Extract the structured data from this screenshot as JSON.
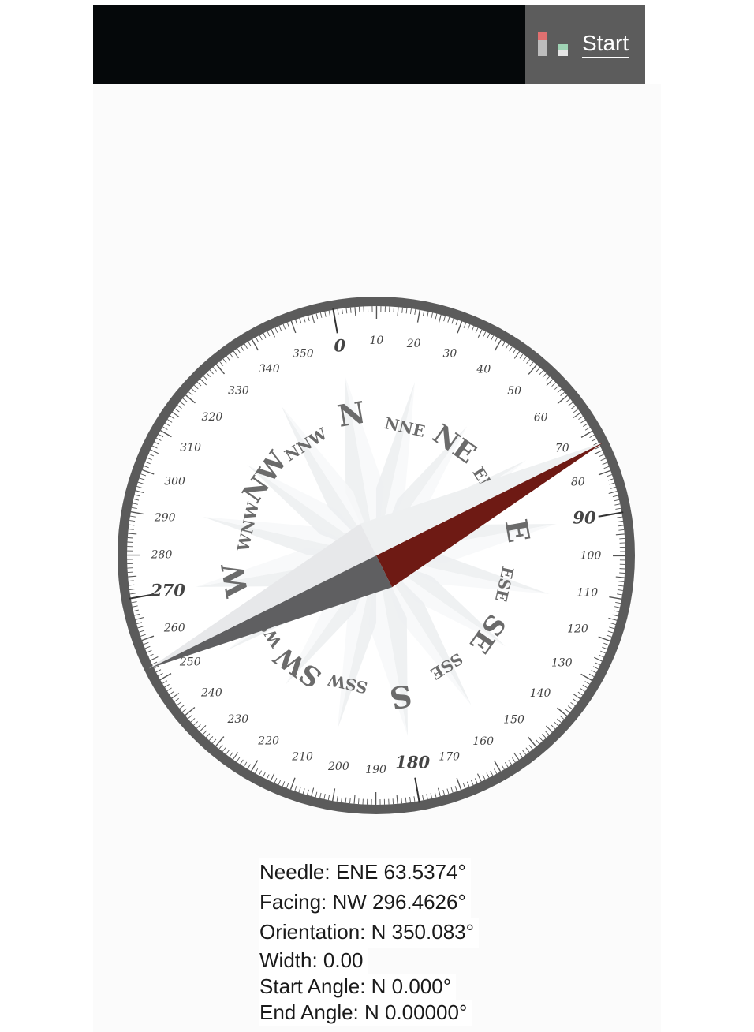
{
  "toolbar": {
    "start_label": "Start",
    "start_icon": "signal-bars-icon"
  },
  "compass": {
    "heading_ring_labels": [
      "0",
      "10",
      "20",
      "30",
      "40",
      "50",
      "60",
      "70",
      "80",
      "90",
      "100",
      "110",
      "120",
      "130",
      "140",
      "150",
      "160",
      "170",
      "180",
      "190",
      "200",
      "210",
      "220",
      "230",
      "240",
      "250",
      "260",
      "270",
      "280",
      "290",
      "300",
      "310",
      "320",
      "330",
      "340",
      "350"
    ],
    "cardinal_labels": [
      "N",
      "NNE",
      "NE",
      "ENE",
      "E",
      "ESE",
      "SE",
      "SSE",
      "S",
      "SSW",
      "SW",
      "WSW",
      "W",
      "WNW",
      "NW",
      "NNW"
    ],
    "rose_rotation_deg": 350.083,
    "needle_bearing_deg": 63.5374,
    "needle_color": "#6e1a14",
    "needle_tail_color": "#5f5f61",
    "ring_color": "#5b5b5b"
  },
  "readout": {
    "needle": "Needle: ENE 63.5374°",
    "facing": "Facing: NW 296.4626°",
    "orientation": "Orientation: N 350.083°",
    "width": "Width: 0.00",
    "start_angle": "Start Angle: N 0.000°",
    "end_angle": "End Angle: N 0.00000°"
  }
}
